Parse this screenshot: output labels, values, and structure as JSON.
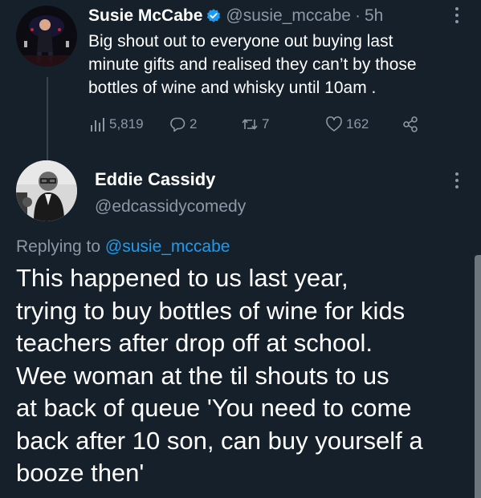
{
  "tweet1": {
    "author_name": "Susie McCabe",
    "handle": "@susie_mccabe",
    "separator": "·",
    "time": "5h",
    "body_lines": [
      "Big shout out to everyone out buying last",
      "minute gifts and realised they can’t by those",
      "bottles of wine and whisky until 10am ."
    ],
    "stats": {
      "views": "5,819",
      "replies": "2",
      "retweets": "7",
      "likes": "162"
    }
  },
  "tweet2": {
    "author_name": "Eddie Cassidy",
    "handle": "@edcassidycomedy",
    "replying_prefix": "Replying to",
    "replying_to": "@susie_mccabe",
    "body_lines": [
      "This happened to us last year,",
      "trying to buy bottles of wine for kids",
      "teachers after drop off at school.",
      "Wee woman at the til shouts to us",
      "at back of queue 'You need to come",
      "back after 10 son, can buy yourself a",
      "booze then'"
    ]
  },
  "icons": [
    "verified-badge-icon",
    "more-icon",
    "views-icon",
    "reply-icon",
    "retweet-icon",
    "like-icon",
    "share-icon"
  ],
  "colors": {
    "background": "#15202b",
    "text": "#ffffff",
    "secondary": "#8b98a5",
    "accent": "#1d9bf0"
  }
}
